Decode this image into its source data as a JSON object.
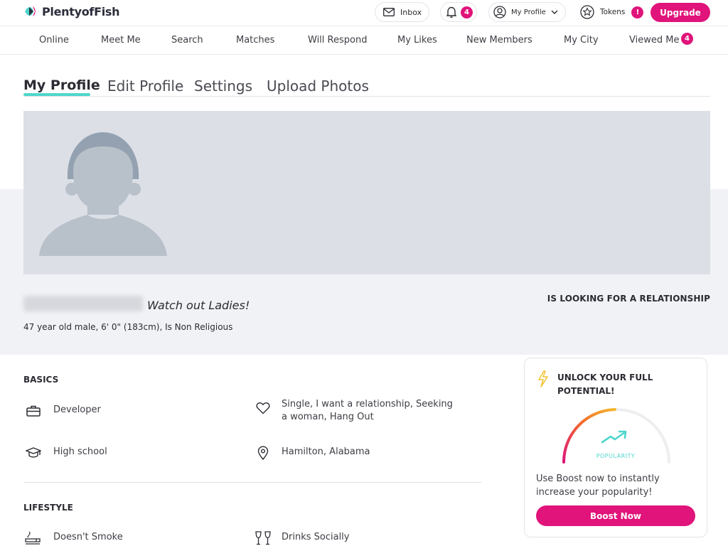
{
  "brand": {
    "name": "PlentyofFish",
    "accent": "#e0147a",
    "teal": "#4fd6cc"
  },
  "topbar": {
    "inbox_label": "Inbox",
    "notifications_count": "4",
    "profile_label": "My Profile",
    "tokens_label": "Tokens",
    "tokens_badge": "!",
    "upgrade_label": "Upgrade"
  },
  "nav": {
    "items": [
      "Online",
      "Meet Me",
      "Search",
      "Matches",
      "Will Respond",
      "My Likes",
      "New Members",
      "My City",
      "Viewed Me"
    ],
    "viewed_me_count": "4"
  },
  "tabs": [
    "My Profile",
    "Edit Profile",
    "Settings",
    "Upload Photos"
  ],
  "profile": {
    "headline": "Watch out Ladies!",
    "looking_for": "IS LOOKING FOR A RELATIONSHIP",
    "details": "47 year old male, 6' 0\" (183cm), Is Non Religious"
  },
  "basics": {
    "title": "BASICS",
    "occupation": "Developer",
    "relationship": "Single, I want a relationship, Seeking a woman, Hang Out",
    "education": "High school",
    "location": "Hamilton, Alabama"
  },
  "lifestyle": {
    "title": "LIFESTYLE",
    "smoking": "Doesn't Smoke",
    "drinking": "Drinks Socially"
  },
  "boost": {
    "title": "UNLOCK YOUR FULL POTENTIAL!",
    "gauge_label": "POPULARITY",
    "text": "Use Boost now to instantly increase your popularity!",
    "button_label": "Boost Now"
  }
}
